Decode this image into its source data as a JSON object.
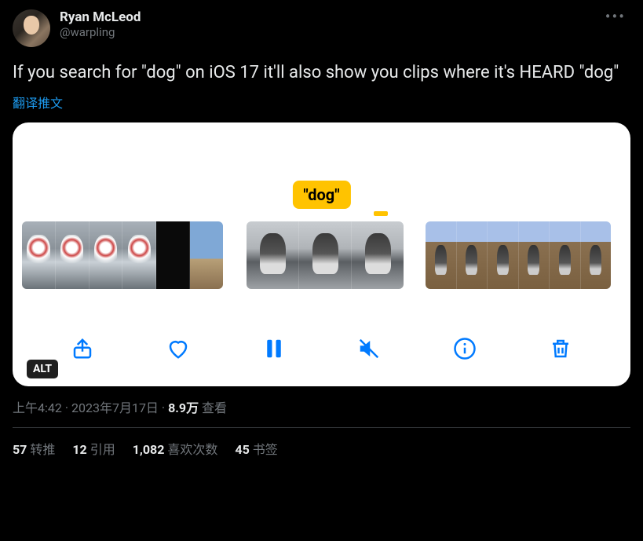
{
  "author": {
    "display_name": "Ryan McLeod",
    "handle": "@warpling"
  },
  "content_text": "If you search for \"dog\" on iOS 17 it'll also show you clips where it's HEARD \"dog\"",
  "translate_label": "翻译推文",
  "media": {
    "tooltip": "\"dog\"",
    "alt_badge": "ALT",
    "controls": [
      "share",
      "like",
      "pause",
      "mute",
      "info",
      "delete"
    ]
  },
  "meta": {
    "time": "上午4:42",
    "sep1": " · ",
    "date": "2023年7月17日",
    "sep2": " · ",
    "views_count": "8.9万",
    "views_label": " 查看"
  },
  "stats": {
    "retweets_count": "57",
    "retweets_label": "转推",
    "quotes_count": "12",
    "quotes_label": "引用",
    "likes_count": "1,082",
    "likes_label": "喜欢次数",
    "bookmarks_count": "45",
    "bookmarks_label": "书签"
  }
}
